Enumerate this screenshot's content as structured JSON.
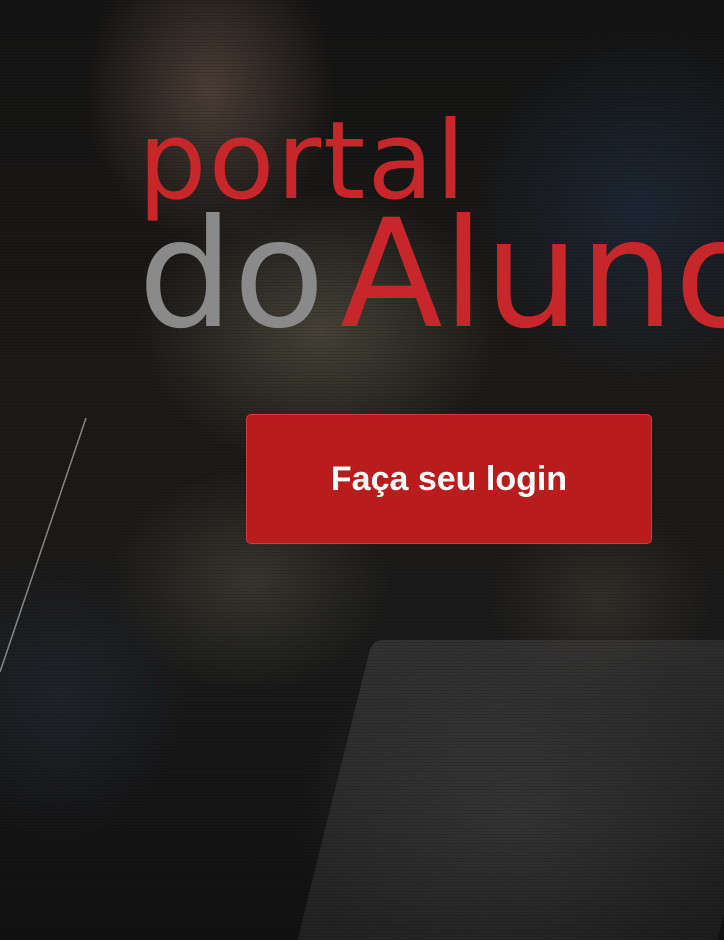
{
  "logo": {
    "line1": "portal",
    "word_do": "do",
    "word_aluno": "Aluno",
    "primary_color": "#c7272b",
    "secondary_color": "#8a8a8a"
  },
  "login": {
    "label": "Faça seu login",
    "color": "#b91c1c"
  }
}
